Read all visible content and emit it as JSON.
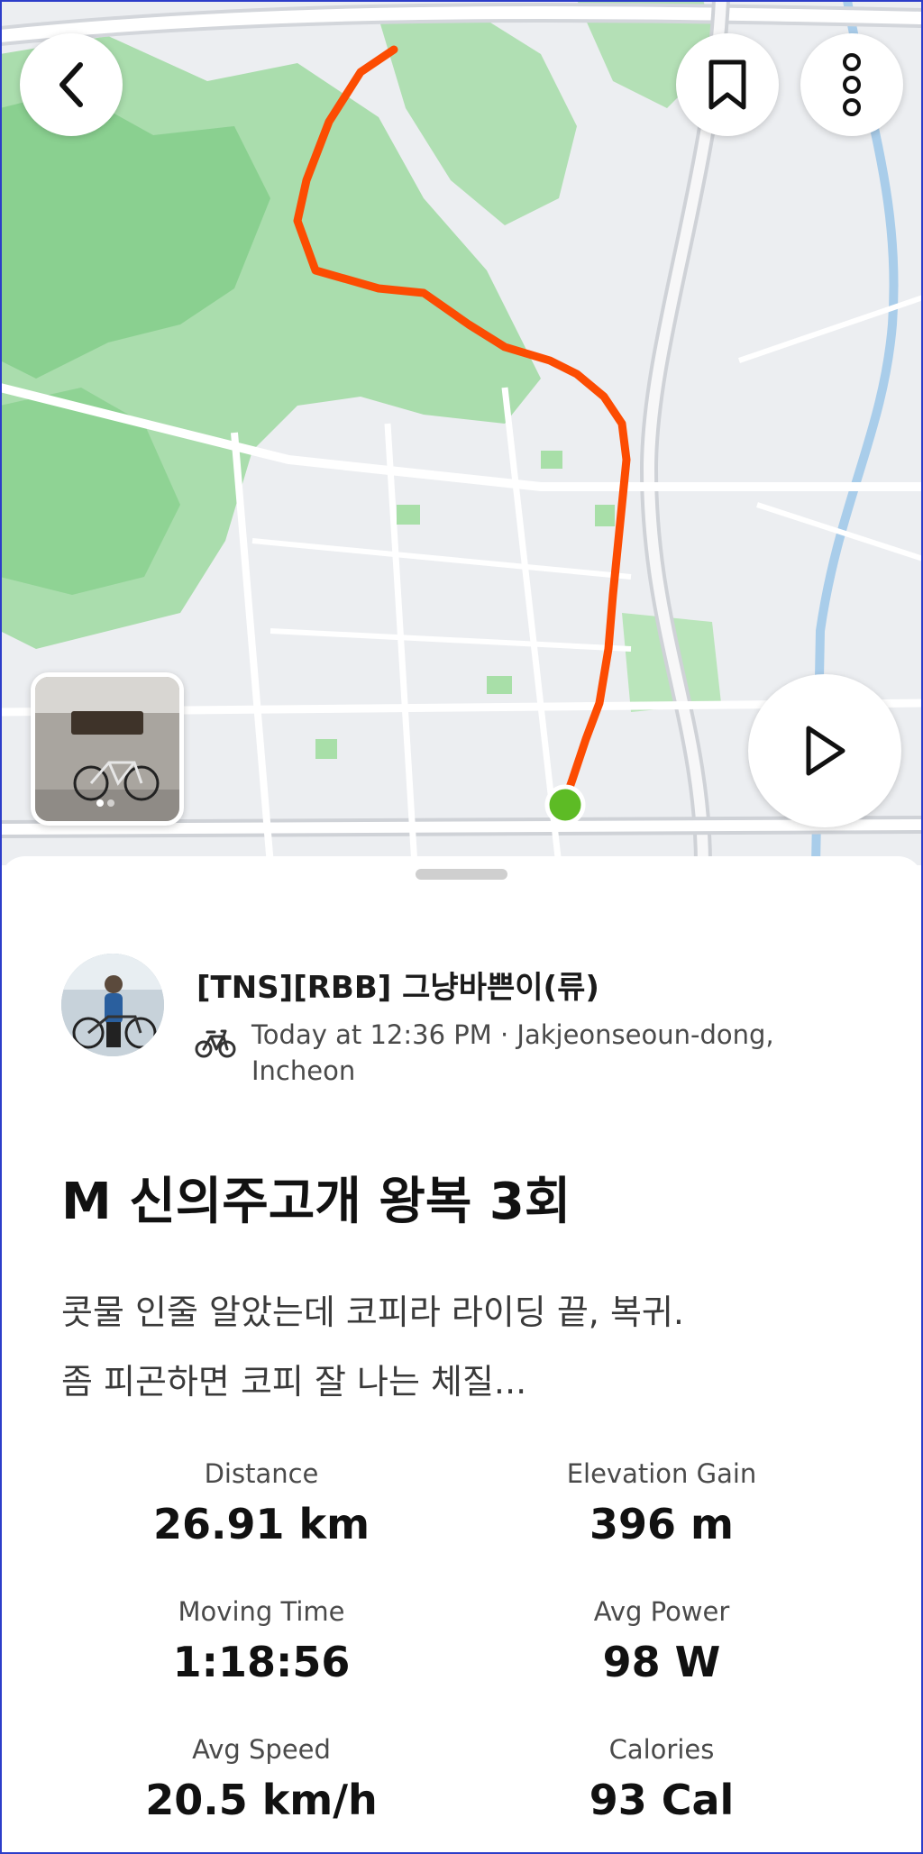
{
  "map": {
    "back_icon": "chevron-left-icon",
    "bookmark_icon": "bookmark-icon",
    "more_icon": "more-vertical-icon",
    "play_icon": "play-icon",
    "route_color": "#fc4c02",
    "start_marker_color": "#5dbb25"
  },
  "athlete": {
    "name": "[TNS][RBB] 그냥바쁜이(류)",
    "activity_icon": "bicycle-icon",
    "meta": "Today at 12:36 PM · Jakjeonseoun-dong, Incheon"
  },
  "activity": {
    "title": "M 신의주고개 왕복 3회",
    "description_lines": [
      "콧물 인줄 알았는데 코피라 라이딩 끝, 복귀.",
      "좀 피곤하면 코피 잘 나는 체질..."
    ]
  },
  "stats": [
    {
      "label": "Distance",
      "value": "26.91 km"
    },
    {
      "label": "Elevation Gain",
      "value": "396 m"
    },
    {
      "label": "Moving Time",
      "value": "1:18:56"
    },
    {
      "label": "Avg Power",
      "value": "98 W"
    },
    {
      "label": "Avg Speed",
      "value": "20.5 km/h"
    },
    {
      "label": "Calories",
      "value": "93 Cal"
    }
  ]
}
